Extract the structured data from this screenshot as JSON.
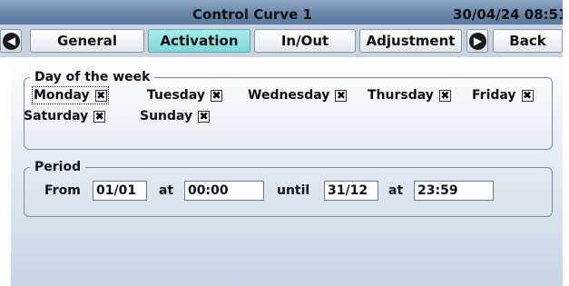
{
  "header": {
    "title": "Control Curve 1",
    "datetime": "30/04/24 08:51"
  },
  "tabs": {
    "prev_icon": "arrow-left-circle-icon",
    "next_icon": "arrow-right-circle-icon",
    "items": [
      {
        "label": "General",
        "active": false
      },
      {
        "label": "Activation",
        "active": true
      },
      {
        "label": "In/Out",
        "active": false
      },
      {
        "label": "Adjustment",
        "active": false
      }
    ],
    "back_label": "Back"
  },
  "day_of_week": {
    "legend": "Day of the week",
    "check_mark": "✖",
    "days": [
      {
        "label": "Monday",
        "checked": true
      },
      {
        "label": "Tuesday",
        "checked": true
      },
      {
        "label": "Wednesday",
        "checked": true
      },
      {
        "label": "Thursday",
        "checked": true
      },
      {
        "label": "Friday",
        "checked": true
      },
      {
        "label": "Saturday",
        "checked": true
      },
      {
        "label": "Sunday",
        "checked": true
      }
    ]
  },
  "period": {
    "legend": "Period",
    "from_label": "From",
    "from_date": "01/01",
    "at_label": "at",
    "from_time": "00:00",
    "until_label": "until",
    "until_date": "31/12",
    "until_time": "23:59"
  },
  "colors": {
    "title_bar": "#6a86aa",
    "active_tab": "#8fdcdc",
    "tab_bar": "#c9d2de"
  }
}
